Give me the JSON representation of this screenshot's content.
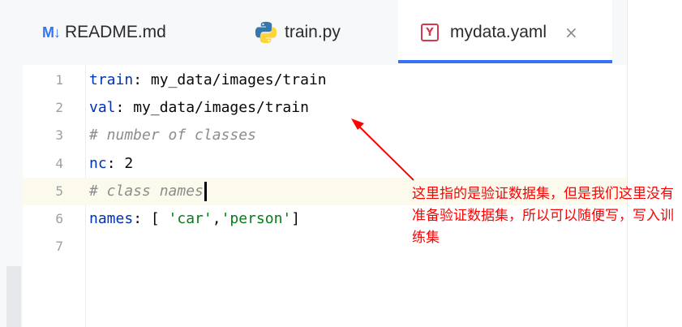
{
  "tabs": [
    {
      "icon": "markdown-icon",
      "icon_text": "M↓",
      "label": "README.md",
      "active": false
    },
    {
      "icon": "python-icon",
      "label": "train.py",
      "active": false
    },
    {
      "icon": "yaml-icon",
      "icon_text": "Y",
      "label": "mydata.yaml",
      "active": true,
      "close": "×"
    }
  ],
  "editor": {
    "line_numbers": [
      "1",
      "2",
      "3",
      "4",
      "5",
      "6",
      "7"
    ],
    "lines": [
      {
        "key": "train",
        "sep": ": ",
        "value": "my_data/images/train"
      },
      {
        "key": "val",
        "sep": ": ",
        "value": "my_data/images/train"
      },
      {
        "comment": "# number of classes"
      },
      {
        "key": "nc",
        "sep": ": ",
        "value": "2"
      },
      {
        "comment": "# class names"
      },
      {
        "key": "names",
        "sep": ": [ ",
        "str1": "'car'",
        "comma": ",",
        "str2": "'person'",
        "end": "]"
      },
      {}
    ],
    "current_line": 5
  },
  "annotation": {
    "text": "这里指的是验证数据集，但是我们这里没有准备验证数据集，所以可以随便写，写入训练集",
    "color": "#ff0000"
  },
  "colors": {
    "accent": "#3574f0",
    "key": "#0033b3",
    "string": "#067d17",
    "comment": "#8c8c8c"
  }
}
